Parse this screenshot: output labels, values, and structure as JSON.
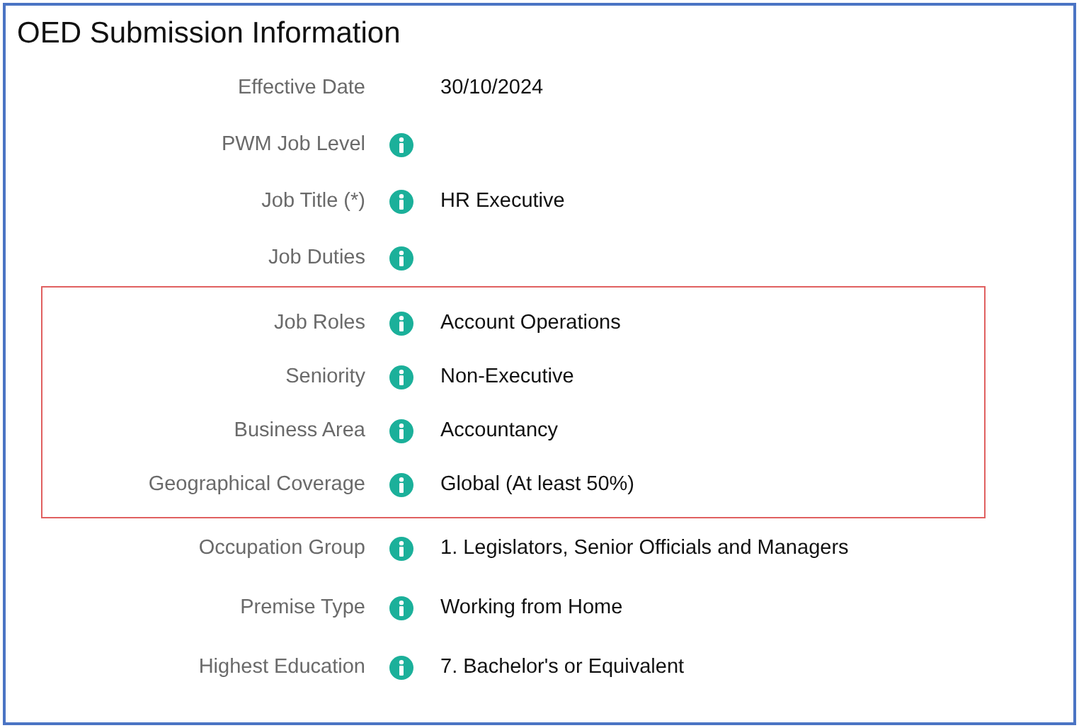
{
  "title": "OED Submission Information",
  "sections": [
    {
      "highlighted": false,
      "rows": [
        {
          "label": "Effective Date",
          "info": false,
          "value": "30/10/2024"
        },
        {
          "label": "PWM Job Level",
          "info": true
        },
        {
          "label": "Job Title (*)",
          "info": true,
          "value": "HR Executive"
        },
        {
          "label": "Job Duties",
          "info": true
        }
      ]
    },
    {
      "highlighted": true,
      "rows": [
        {
          "label": "Job Roles",
          "info": true,
          "value": "Account Operations"
        },
        {
          "label": "Seniority",
          "info": true,
          "value": "Non-Executive"
        },
        {
          "label": "Business Area",
          "info": true,
          "value": "Accountancy"
        },
        {
          "label": "Geographical Coverage",
          "info": true,
          "value": "Global (At least 50%)"
        }
      ]
    },
    {
      "highlighted": false,
      "rows": [
        {
          "label": "Occupation Group",
          "info": true,
          "value": "1. Legislators, Senior Officials and Managers"
        },
        {
          "label": "Premise Type",
          "info": true,
          "value": "Working from Home"
        },
        {
          "label": "Highest Education",
          "info": true,
          "value": "7. Bachelor's or Equivalent"
        }
      ]
    }
  ]
}
